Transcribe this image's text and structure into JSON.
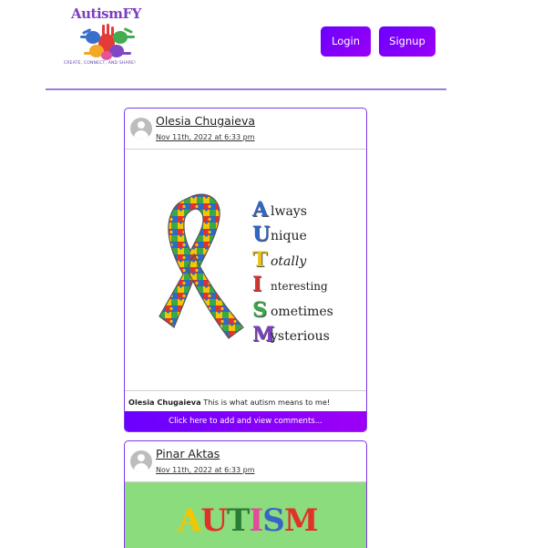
{
  "header": {
    "logo_text": "AutismFY",
    "logo_tagline": "CREATE, CONNECT, AND SHARE!",
    "login_label": "Login",
    "signup_label": "Signup",
    "accent_color": "#7a1cff"
  },
  "posts": [
    {
      "author": "Olesia Chugaieva",
      "date": "Nov 11th, 2022 at 6:33 pm",
      "image": {
        "acrostic": [
          {
            "letter": "A",
            "rest": "lways",
            "color": "#2e68c9"
          },
          {
            "letter": "U",
            "rest": "nique",
            "color": "#2e68c9"
          },
          {
            "letter": "T",
            "rest": "otally",
            "color": "#e9c21a"
          },
          {
            "letter": "I",
            "rest": "nteresting",
            "color": "#d8332a"
          },
          {
            "letter": "S",
            "rest": "ometimes",
            "color": "#3aa845"
          },
          {
            "letter": "M",
            "rest": "ysterious",
            "color": "#7b3fc0"
          }
        ]
      },
      "caption_author": "Olesia Chugaieva",
      "caption_text": "This is what autism means to me!",
      "view_label": "Click here to add and view comments..."
    },
    {
      "author": "Pinar Aktas",
      "date": "Nov 11th, 2022 at 6:33 pm",
      "image": {
        "word": [
          {
            "letter": "A",
            "color": "#f4c600"
          },
          {
            "letter": "U",
            "color": "#e2312b"
          },
          {
            "letter": "T",
            "color": "#2a7d36"
          },
          {
            "letter": "I",
            "color": "#e24a9a"
          },
          {
            "letter": "S",
            "color": "#3a63c8"
          },
          {
            "letter": "M",
            "color": "#e2312b"
          }
        ]
      }
    }
  ]
}
